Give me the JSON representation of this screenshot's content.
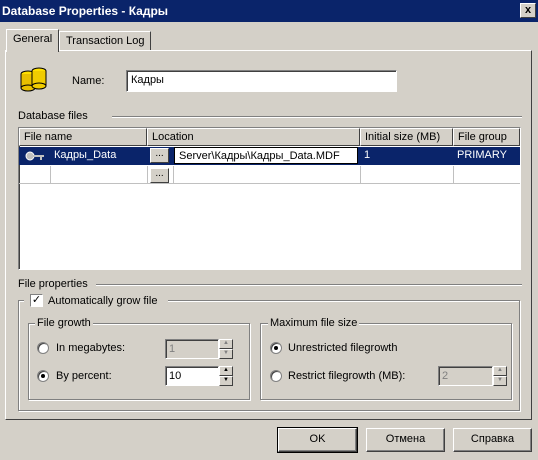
{
  "window": {
    "title": "Database Properties - Кадры",
    "close_glyph": "x"
  },
  "tabs": [
    {
      "label": "General",
      "active": true
    },
    {
      "label": "Transaction Log",
      "active": false
    }
  ],
  "name": {
    "label": "Name:",
    "value": "Кадры"
  },
  "database_files": {
    "label": "Database files",
    "columns": [
      "File name",
      "Location",
      "Initial size (MB)",
      "File group"
    ],
    "rows": [
      {
        "file_name": "Кадры_Data",
        "location": "Server\\Кадры\\Кадры_Data.MDF",
        "initial_size": "1",
        "file_group": "PRIMARY",
        "selected": true,
        "key_icon": "key-icon"
      }
    ],
    "browse_glyph": "..."
  },
  "file_properties": {
    "label": "File properties",
    "auto_grow": {
      "label": "Automatically grow file",
      "checked": true,
      "check_glyph": "✓"
    },
    "file_growth": {
      "label": "File growth",
      "in_megabytes": {
        "label": "In megabytes:",
        "selected": false,
        "value": "1",
        "enabled": false
      },
      "by_percent": {
        "label": "By percent:",
        "selected": true,
        "value": "10",
        "enabled": true
      }
    },
    "max_file_size": {
      "label": "Maximum file size",
      "unrestricted": {
        "label": "Unrestricted filegrowth",
        "selected": true
      },
      "restrict": {
        "label": "Restrict filegrowth (MB):",
        "selected": false,
        "value": "2",
        "enabled": false
      }
    }
  },
  "buttons": {
    "ok": "OK",
    "cancel": "Отмена",
    "help": "Справка"
  },
  "colors": {
    "title_bar": "#0a246a",
    "selection": "#0a246a",
    "face": "#d4d0c8",
    "database_icon": "#e8c000"
  }
}
